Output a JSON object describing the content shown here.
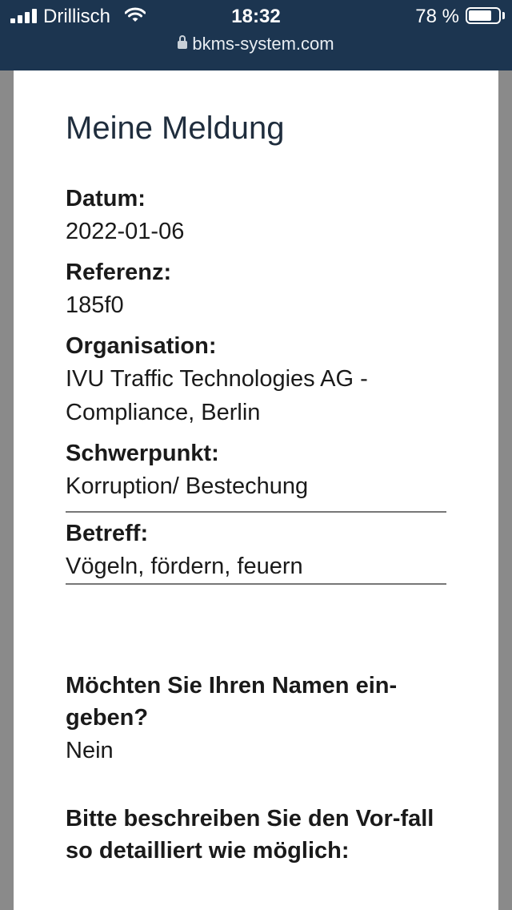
{
  "status_bar": {
    "carrier": "Drillisch",
    "time": "18:32",
    "battery": "78 %",
    "battery_level": 0.78,
    "url": "bkms-system.com"
  },
  "dialog": {
    "title": "Meine Meldung",
    "fields": [
      {
        "label": "Datum:",
        "value": "2022-01-06"
      },
      {
        "label": "Referenz:",
        "value": "185f0"
      },
      {
        "label": "Organisation:",
        "value": "IVU Traffic Technologies AG - Compliance, Berlin"
      },
      {
        "label": "Schwerpunkt:",
        "value": "Korruption/ Bestechung"
      },
      {
        "label": "Betreff:",
        "value": "Vögeln, fördern, feuern"
      }
    ],
    "questions": [
      {
        "label": "Möchten Sie Ihren Namen ein-geben?",
        "value": "Nein"
      },
      {
        "label": "Bitte beschreiben Sie den Vor-fall so detailliert wie möglich:",
        "value": ""
      }
    ]
  }
}
